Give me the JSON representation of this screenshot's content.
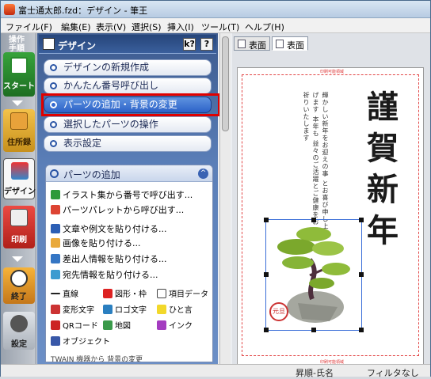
{
  "window": {
    "title": "富士通太郎.fzd：デザイン - 筆王"
  },
  "menu": [
    "ファイル(F)",
    "編集(E)",
    "表示(V)",
    "選択(S)",
    "挿入(I)",
    "ツール(T)",
    "ヘルプ(H)"
  ],
  "leftbar": {
    "header": [
      "操作",
      "手順"
    ],
    "items": [
      {
        "label": "スタート"
      },
      {
        "label": "住所録"
      },
      {
        "label": "デザイン"
      },
      {
        "label": "印刷"
      },
      {
        "label": "終了"
      },
      {
        "label": "設定"
      }
    ]
  },
  "panel": {
    "title": "デザイン",
    "help_label": "?",
    "tip_label": "k?",
    "actions": [
      {
        "label": "デザインの新規作成"
      },
      {
        "label": "かんたん番号呼び出し"
      },
      {
        "label": "パーツの追加・背景の変更"
      },
      {
        "label": "選択したパーツの操作"
      },
      {
        "label": "表示設定"
      }
    ],
    "sub": {
      "title": "パーツの追加",
      "items": [
        {
          "label": "イラスト集から番号で呼び出す..."
        },
        {
          "label": "パーツパレットから呼び出す..."
        },
        {
          "label": "文章や例文を貼り付ける..."
        },
        {
          "label": "画像を貼り付ける..."
        },
        {
          "label": "差出人情報を貼り付ける..."
        },
        {
          "label": "宛先情報を貼り付ける..."
        }
      ],
      "grid": [
        [
          "直線",
          "図形・枠",
          "項目データ"
        ],
        [
          "変形文字",
          "ロゴ文字",
          "ひと言"
        ],
        [
          "QRコード",
          "地図",
          "インク"
        ],
        [
          "オブジェクト"
        ]
      ],
      "cut_label": "TWAIN 機器から  背景の変更"
    }
  },
  "doc": {
    "tabs": [
      {
        "label": "表面"
      },
      {
        "label": "表面"
      }
    ],
    "card": {
      "top_mark": "印刷可能領域",
      "bottom_mark": "印刷可能領域",
      "greeting": "謹賀新年",
      "lines": [
        "輝かしい新年をお迎えの事",
        "とお喜び申し上げます",
        "本年も",
        "益々のご活躍とご健康をお",
        "祈りいたします"
      ],
      "stamp": "元旦"
    }
  },
  "status": {
    "sort": "昇順-氏名",
    "filter": "フィルタなし"
  },
  "colors": {
    "panel": "#4a6aa3",
    "highlight": "#e00000",
    "selected": "#2c62c8"
  }
}
